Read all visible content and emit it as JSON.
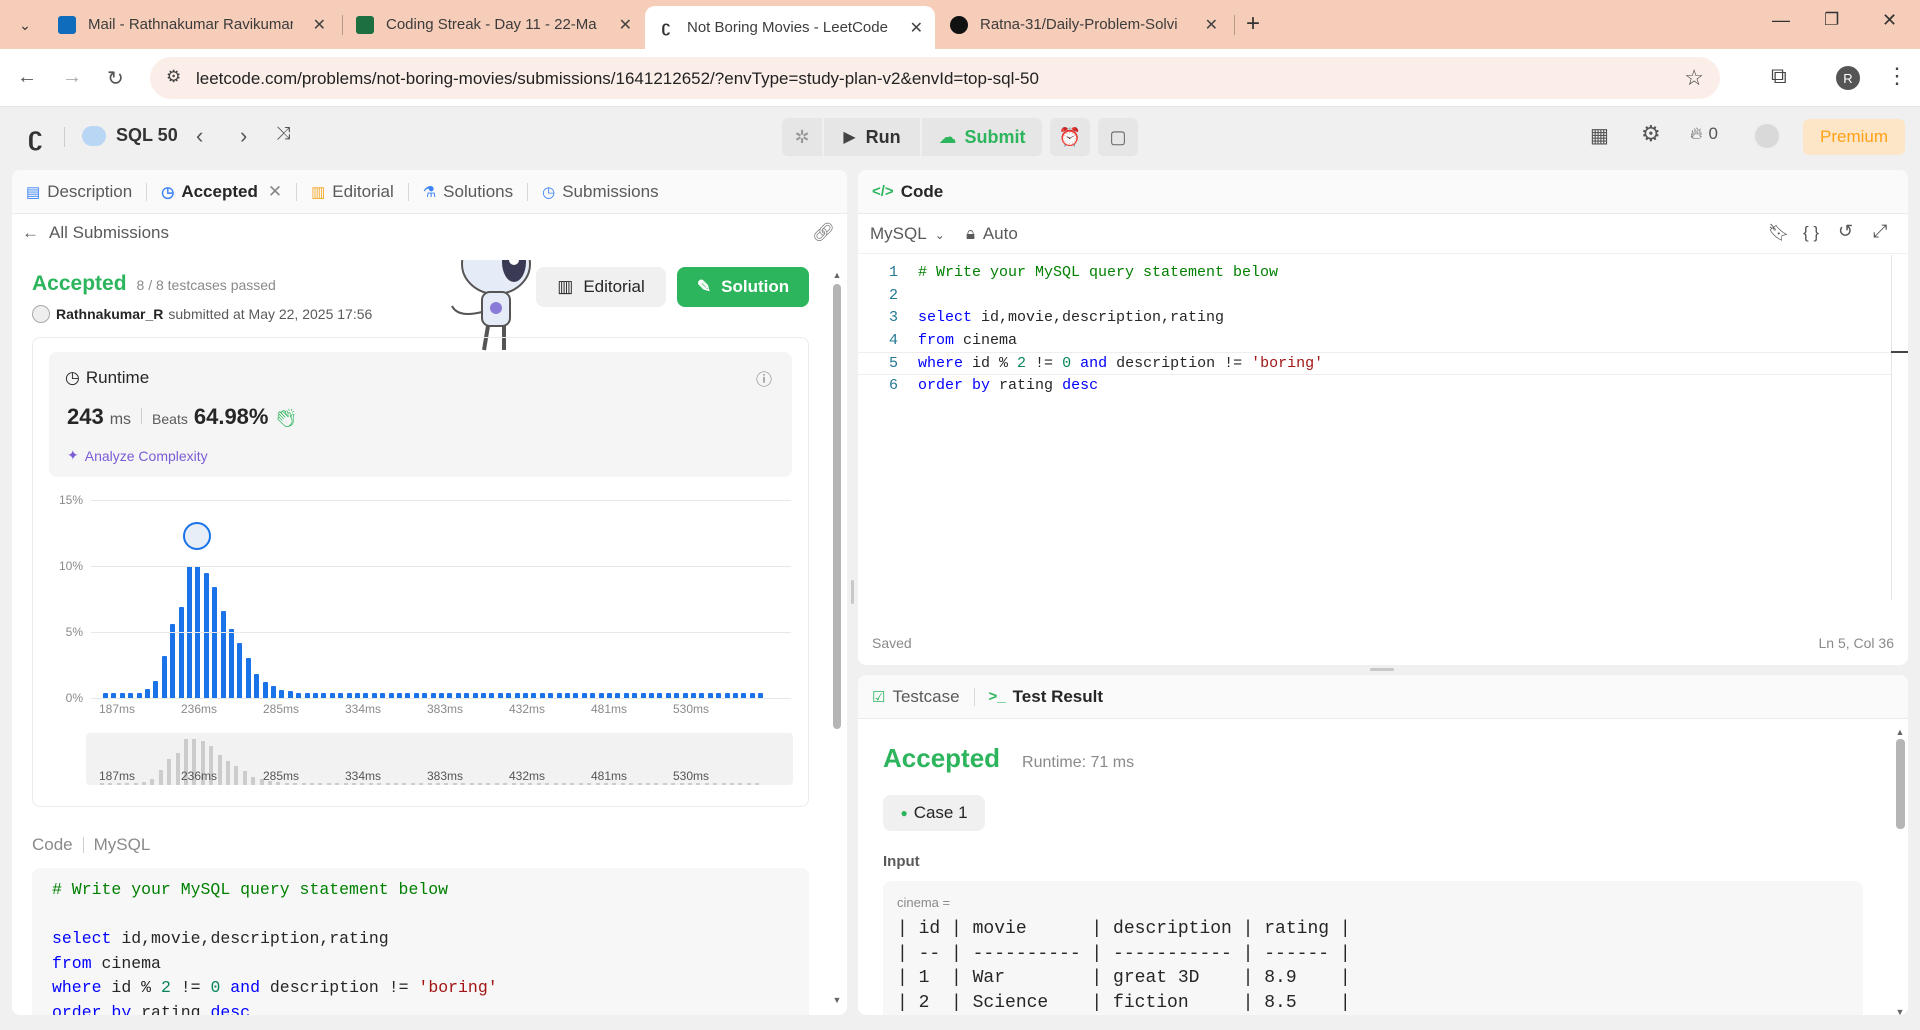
{
  "browser": {
    "tabs": [
      {
        "title": "Mail - Rathnakumar Ravikumar",
        "icon": "outlook-icon",
        "color": "#0f6cbd"
      },
      {
        "title": "Coding Streak - Day 11 - 22-Ma",
        "icon": "sheets-icon",
        "color": "#1d6f42"
      },
      {
        "title": "Not Boring Movies - LeetCode",
        "icon": "leetcode-icon",
        "color": "#ffa116",
        "active": true
      },
      {
        "title": "Ratna-31/Daily-Problem-Solvi",
        "icon": "github-icon",
        "color": "#111111"
      }
    ],
    "url": "leetcode.com/problems/not-boring-movies/submissions/1641212652/?envType=study-plan-v2&envId=top-sql-50",
    "profile_initial": "R"
  },
  "header": {
    "study_plan": "SQL 50",
    "run_label": "Run",
    "submit_label": "Submit",
    "streak_count": "0",
    "premium_label": "Premium"
  },
  "left_tabs": {
    "description": "Description",
    "accepted": "Accepted",
    "editorial": "Editorial",
    "solutions": "Solutions",
    "submissions": "Submissions"
  },
  "submission": {
    "back_label": "All Submissions",
    "status": "Accepted",
    "testcases": "8 / 8 testcases passed",
    "user": "Rathnakumar_R",
    "submitted_text": "submitted at May 22, 2025 17:56",
    "editorial_btn": "Editorial",
    "solution_btn": "Solution",
    "runtime_title": "Runtime",
    "runtime_value": "243",
    "runtime_unit": "ms",
    "beats_label": "Beats",
    "beats_value": "64.98%",
    "analyze_label": "Analyze Complexity",
    "code_label": "Code",
    "lang_label": "MySQL"
  },
  "chart_data": {
    "type": "bar",
    "ylabel": "",
    "y_ticks": [
      "15%",
      "10%",
      "5%",
      "0%"
    ],
    "ylim": [
      0,
      15
    ],
    "x_ticks": [
      "187ms",
      "236ms",
      "285ms",
      "334ms",
      "383ms",
      "432ms",
      "481ms",
      "530ms"
    ],
    "values": [
      0.4,
      0.4,
      0.4,
      0.4,
      0.4,
      0.7,
      1.3,
      3.2,
      5.6,
      6.9,
      10,
      10,
      9.5,
      8.4,
      6.6,
      5.2,
      4.2,
      3,
      1.8,
      1.2,
      0.9,
      0.6,
      0.5,
      0.4,
      0.4,
      0.4,
      0.4,
      0.4,
      0.4,
      0.4,
      0.4,
      0.4,
      0.4,
      0.4,
      0.4,
      0.4,
      0.4,
      0.4,
      0.4,
      0.4,
      0.4,
      0.4,
      0.4,
      0.4,
      0.4,
      0.4,
      0.4,
      0.4,
      0.4,
      0.4,
      0.4,
      0.4,
      0.4,
      0.4,
      0.4,
      0.4,
      0.4,
      0.4,
      0.4,
      0.4,
      0.4,
      0.4,
      0.4,
      0.4,
      0.4,
      0.4,
      0.4,
      0.4,
      0.4,
      0.4,
      0.4,
      0.4,
      0.4,
      0.4,
      0.4,
      0.4,
      0.4,
      0.4,
      0.4
    ],
    "user_bar_index": 11,
    "bar_color": "#1a73e8"
  },
  "submission_code": [
    "# Write your MySQL query statement below",
    "",
    "select id,movie,description,rating",
    "from cinema",
    "where id % 2 != 0 and description != 'boring'",
    "order by rating desc"
  ],
  "editor": {
    "title": "Code",
    "language": "MySQL",
    "mode": "Auto",
    "saved": "Saved",
    "cursor": "Ln 5, Col 36",
    "lines": [
      "# Write your MySQL query statement below",
      "",
      "select id,movie,description,rating",
      "from cinema",
      "where id % 2 != 0 and description != 'boring'",
      "order by rating desc"
    ]
  },
  "result": {
    "testcase_tab": "Testcase",
    "result_tab": "Test Result",
    "status": "Accepted",
    "runtime": "Runtime: 71 ms",
    "case_label": "Case 1",
    "input_label": "Input",
    "table_name": "cinema =",
    "table_rows": [
      "| id | movie      | description | rating |",
      "| -- | ---------- | ----------- | ------ |",
      "| 1  | War        | great 3D    | 8.9    |",
      "| 2  | Science    | fiction     | 8.5    |"
    ]
  }
}
